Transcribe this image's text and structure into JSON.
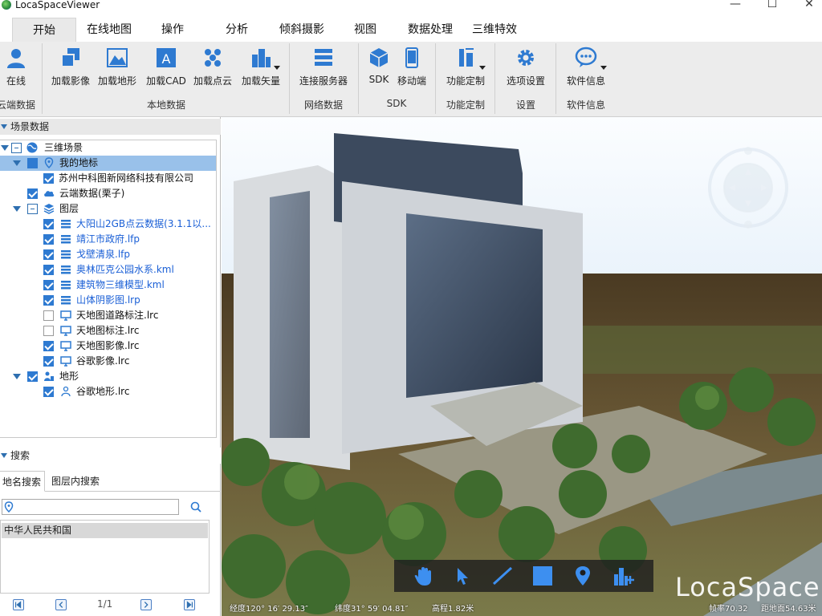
{
  "window": {
    "title": "LocaSpaceViewer",
    "minimize": "—",
    "maximize": "☐",
    "close": "✕"
  },
  "tabs": [
    "开始",
    "在线地图",
    "操作",
    "分析",
    "倾斜摄影",
    "视图",
    "数据处理",
    "三维特效"
  ],
  "ribbon": {
    "buttons": {
      "online": "在线",
      "load_image": "加载影像",
      "load_terrain": "加载地形",
      "load_cad": "加载CAD",
      "load_pointcloud": "加载点云",
      "load_vector": "加载矢量",
      "connect_server": "连接服务器",
      "sdk": "SDK",
      "mobile": "移动端",
      "func_custom": "功能定制",
      "options": "选项设置",
      "software_info": "软件信息"
    },
    "groups": {
      "cloud": "云端数据",
      "local": "本地数据",
      "network": "网络数据",
      "sdk": "SDK",
      "func": "功能定制",
      "settings": "设置",
      "info": "软件信息"
    }
  },
  "scene_panel": {
    "title": "场景数据",
    "tree": [
      {
        "label": "三维场景"
      },
      {
        "label": "我的地标"
      },
      {
        "label": "苏州中科图新网络科技有限公司"
      },
      {
        "label": "云端数据(栗子)"
      },
      {
        "label": "图层"
      },
      {
        "label": "大阳山2GB点云数据(3.1.1以..."
      },
      {
        "label": "靖江市政府.lfp"
      },
      {
        "label": "戈壁清泉.lfp"
      },
      {
        "label": "奥林匹克公园水系.kml"
      },
      {
        "label": "建筑物三维模型.kml"
      },
      {
        "label": "山体阴影图.lrp"
      },
      {
        "label": "天地图道路标注.lrc"
      },
      {
        "label": "天地图标注.lrc"
      },
      {
        "label": "天地图影像.lrc"
      },
      {
        "label": "谷歌影像.lrc"
      },
      {
        "label": "地形"
      },
      {
        "label": "谷歌地形.lrc"
      }
    ]
  },
  "search_panel": {
    "title": "搜索",
    "tab_place": "地名搜索",
    "tab_layer": "图层内搜索",
    "query": "",
    "results": [
      "中华人民共和国"
    ],
    "page": "1/1"
  },
  "viewport": {
    "brand": "LocaSpace",
    "status_lon": "经度120° 16′ 29.13″",
    "status_lat": "纬度31° 59′ 04.81″",
    "status_alt": "高程1.82米",
    "status_fps": "帧率70.32",
    "status_ground": "距地面54.63米"
  },
  "colors": {
    "accent": "#2e7ad1",
    "selection": "#99c1ea",
    "link": "#1a5fd6",
    "ribbon_bg": "#ececec"
  }
}
